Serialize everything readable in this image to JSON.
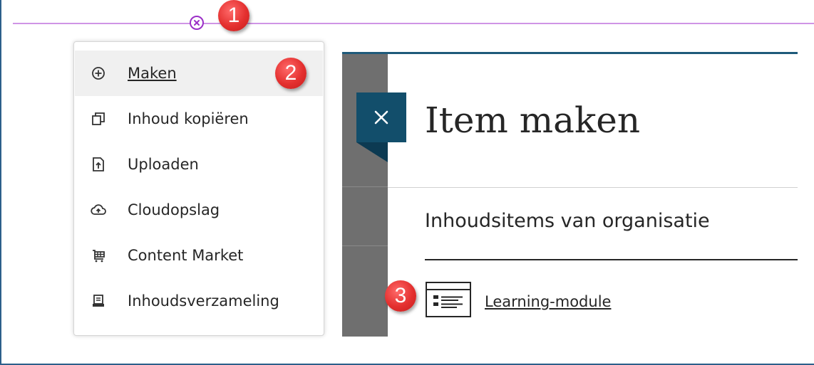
{
  "colors": {
    "frame_border": "#2c5f8a",
    "divider": "#cf94e6",
    "add_button": "#9b2fc7",
    "badge": "#e4302f",
    "panel_dark": "#124e6b",
    "panel_gray": "#6f6f6f"
  },
  "badges": [
    "1",
    "2",
    "3"
  ],
  "menu": {
    "items": [
      {
        "label": "Maken",
        "icon": "plus-circle-icon",
        "active": true
      },
      {
        "label": "Inhoud kopiëren",
        "icon": "copy-icon",
        "active": false
      },
      {
        "label": "Uploaden",
        "icon": "upload-file-icon",
        "active": false
      },
      {
        "label": "Cloudopslag",
        "icon": "cloud-upload-icon",
        "active": false
      },
      {
        "label": "Content Market",
        "icon": "shopping-cart-icon",
        "active": false
      },
      {
        "label": "Inhoudsverzameling",
        "icon": "content-collection-icon",
        "active": false
      }
    ]
  },
  "panel": {
    "close_icon": "close-icon",
    "title": "Item maken",
    "section_heading": "Inhoudsitems van organisatie",
    "items": [
      {
        "label": "Learning-module",
        "icon": "learning-module-icon"
      }
    ]
  }
}
